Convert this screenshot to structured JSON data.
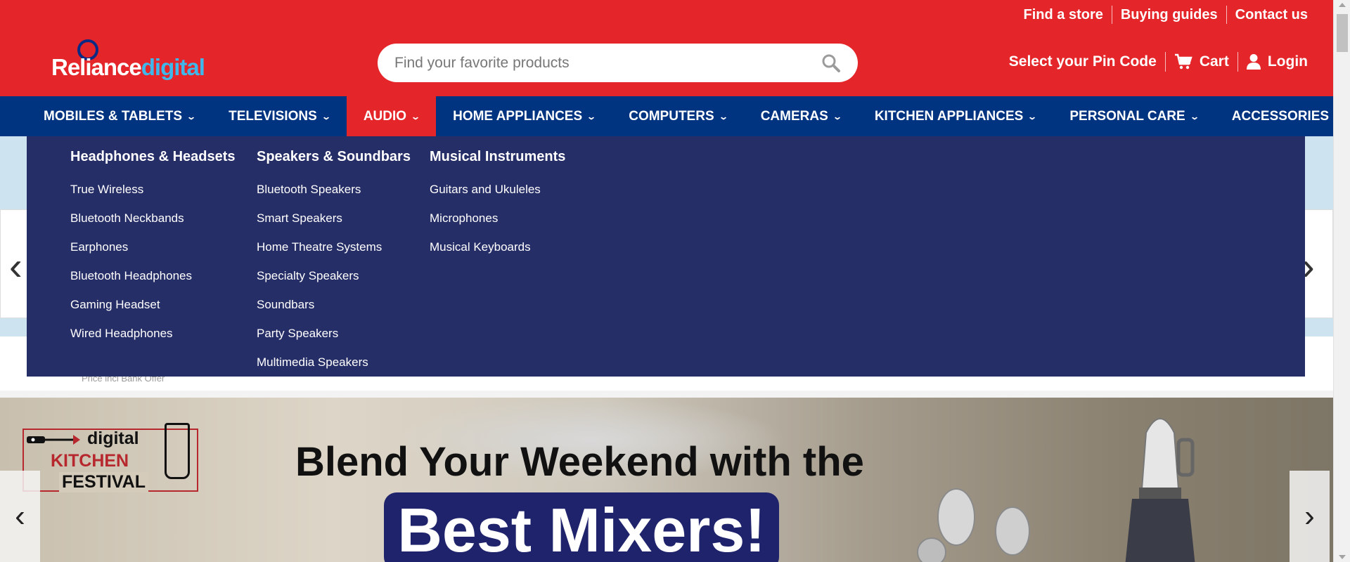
{
  "header": {
    "top_links": [
      "Find a store",
      "Buying guides",
      "Contact us"
    ],
    "logo": {
      "part1": "Reliance",
      "part2": "digital"
    },
    "search": {
      "placeholder": "Find your favorite products",
      "icon": "search-icon"
    },
    "pin_code_label": "Select your Pin Code",
    "cart_label": "Cart",
    "login_label": "Login"
  },
  "nav": {
    "items": [
      "MOBILES & TABLETS",
      "TELEVISIONS",
      "AUDIO",
      "HOME APPLIANCES",
      "COMPUTERS",
      "CAMERAS",
      "KITCHEN APPLIANCES",
      "PERSONAL CARE",
      "ACCESSORIES"
    ],
    "active_item": "AUDIO"
  },
  "mega_menu": {
    "columns": [
      {
        "heading": "Headphones & Headsets",
        "items": [
          "True Wireless",
          "Bluetooth Neckbands",
          "Earphones",
          "Bluetooth Headphones",
          "Gaming Headset",
          "Wired Headphones"
        ]
      },
      {
        "heading": "Speakers & Soundbars",
        "items": [
          "Bluetooth Speakers",
          "Smart Speakers",
          "Home Theatre Systems",
          "Specialty Speakers",
          "Soundbars",
          "Party Speakers",
          "Multimedia Speakers"
        ]
      },
      {
        "heading": "Musical Instruments",
        "items": [
          "Guitars and Ukuleles",
          "Microphones",
          "Musical Keyboards"
        ]
      }
    ]
  },
  "carousel": {
    "partial_text": "Price incl Bank Offer"
  },
  "banner": {
    "festival_line1": "digital",
    "festival_line2": "KITCHEN",
    "festival_line3": "FESTIVAL",
    "headline": "Blend Your Weekend with the",
    "highlight": "Best Mixers!"
  },
  "colors": {
    "header_red": "#e42529",
    "nav_blue": "#003380",
    "mega_bg": "#262e67",
    "logo_blue": "#3fb7ea"
  }
}
